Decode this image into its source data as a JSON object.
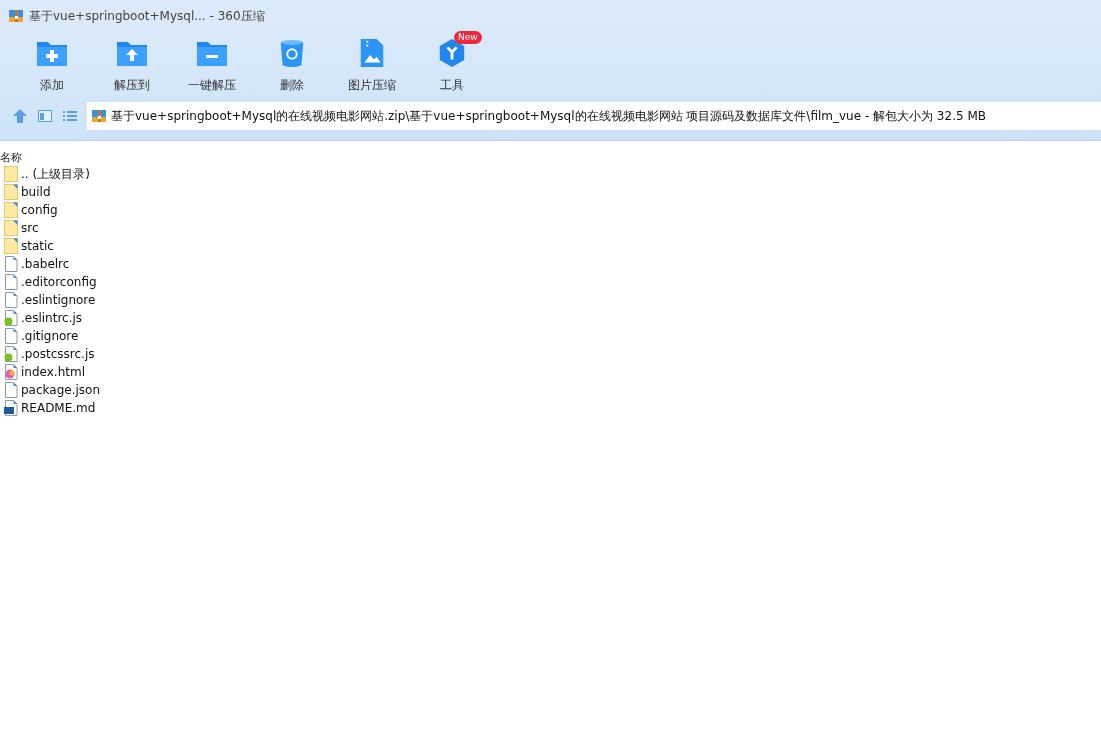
{
  "window": {
    "title": "基于vue+springboot+Mysql... - 360压缩"
  },
  "toolbar": [
    {
      "kind": "add",
      "label": "添加"
    },
    {
      "kind": "extract",
      "label": "解压到"
    },
    {
      "kind": "quick",
      "label": "一键解压"
    },
    {
      "kind": "delete",
      "label": "删除"
    },
    {
      "kind": "image",
      "label": "图片压缩"
    },
    {
      "kind": "tools",
      "label": "工具",
      "badge": "New"
    }
  ],
  "address": {
    "path": "基于vue+springboot+Mysql的在线视频电影网站.zip\\基于vue+springboot+Mysql的在线视频电影网站 项目源码及数据库文件\\film_vue - 解包大小为 32.5 MB"
  },
  "table": {
    "columns": [
      "名称"
    ],
    "rows": [
      {
        "kind": "parent",
        "name": ".. (上级目录)"
      },
      {
        "kind": "folder",
        "name": "build"
      },
      {
        "kind": "folder",
        "name": "config"
      },
      {
        "kind": "folder",
        "name": "src"
      },
      {
        "kind": "folder",
        "name": "static"
      },
      {
        "kind": "file",
        "name": ".babelrc"
      },
      {
        "kind": "file",
        "name": ".editorconfig"
      },
      {
        "kind": "file",
        "name": ".eslintignore"
      },
      {
        "kind": "script",
        "name": ".eslintrc.js"
      },
      {
        "kind": "file",
        "name": ".gitignore"
      },
      {
        "kind": "script",
        "name": ".postcssrc.js"
      },
      {
        "kind": "html",
        "name": "index.html"
      },
      {
        "kind": "file",
        "name": "package.json"
      },
      {
        "kind": "markdown",
        "name": "README.md"
      }
    ]
  }
}
